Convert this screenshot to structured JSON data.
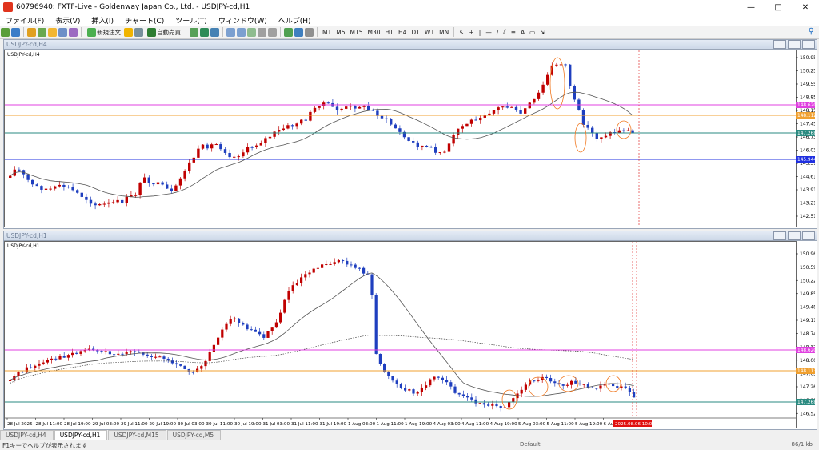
{
  "window": {
    "title": "60796940: FXTF-Live - Goldenway Japan Co., Ltd. - USDJPY-cd,H1",
    "controls": [
      "—",
      "□",
      "✕"
    ]
  },
  "menu": [
    "ファイル(F)",
    "表示(V)",
    "挿入(I)",
    "チャート(C)",
    "ツール(T)",
    "ウィンドウ(W)",
    "ヘルプ(H)"
  ],
  "toolbar": {
    "new_order": "新規注文",
    "auto_trade": "自動売買",
    "timeframes": [
      "M1",
      "M5",
      "M15",
      "M30",
      "H1",
      "H4",
      "D1",
      "W1",
      "MN"
    ],
    "colors": {
      "accent": "#1b6cc4"
    }
  },
  "charts": [
    {
      "caption": "USDJPY-cd,H4",
      "label": "USDJPY-cd,H4",
      "axis_labels": [
        "150.950",
        "150.250",
        "149.550",
        "148.850",
        "148.150",
        "147.450",
        "146.730",
        "146.030",
        "145.310",
        "144.610",
        "143.910",
        "143.210",
        "142.510"
      ],
      "line_tags": {
        "magenta": "148.620",
        "orange": "148.112",
        "teal": "147.268",
        "blue": "145.944"
      }
    },
    {
      "caption": "USDJPY-cd,H1",
      "label": "USDJPY-cd,H1",
      "axis_labels": [
        "150.960",
        "150.590",
        "150.220",
        "149.850",
        "149.480",
        "149.110",
        "148.740",
        "148.370",
        "148.000",
        "147.630",
        "147.260",
        "146.890",
        "146.520"
      ],
      "line_tags": {
        "magenta": "148.620",
        "orange": "148.113",
        "teal": "147.268"
      },
      "time_labels": [
        "28 Jul 2025",
        "28 Jul 11:00",
        "28 Jul 19:00",
        "29 Jul 03:00",
        "29 Jul 11:00",
        "29 Jul 19:00",
        "30 Jul 03:00",
        "30 Jul 11:00",
        "30 Jul 19:00",
        "31 Jul 03:00",
        "31 Jul 11:00",
        "31 Jul 19:00",
        "1 Aug 03:00",
        "1 Aug 11:00",
        "1 Aug 19:00",
        "4 Aug 03:00",
        "4 Aug 11:00",
        "4 Aug 19:00",
        "5 Aug 03:00",
        "5 Aug 11:00",
        "5 Aug 19:00",
        "6 Aug 03:00"
      ],
      "time_tag": "2025.08.06 10:00"
    }
  ],
  "tabs": [
    "USDJPY-cd,H4",
    "USDJPY-cd,H1",
    "USDJPY-cd,M15",
    "USDJPY-cd,M5"
  ],
  "status": {
    "message": "F1キーでヘルプが表示されます",
    "mid": "Default",
    "right": "86/1 kb"
  }
}
